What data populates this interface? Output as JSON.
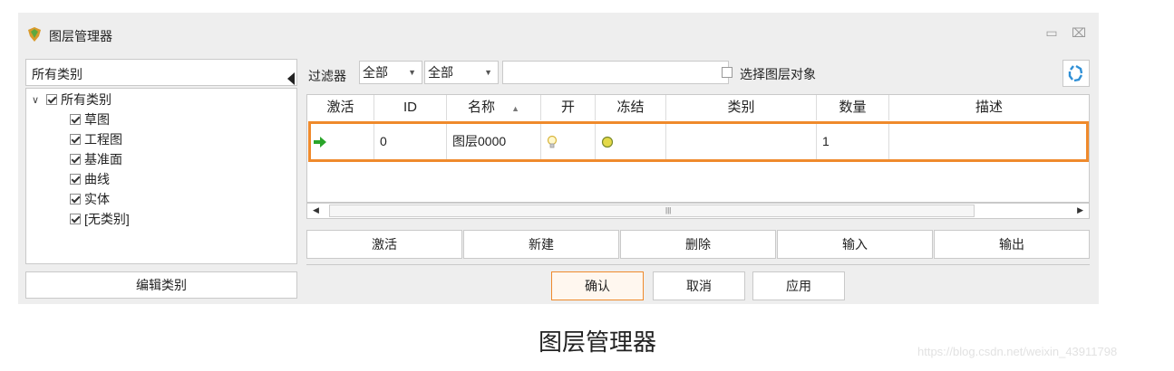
{
  "window": {
    "title": "图层管理器",
    "close_glyph": "⌧",
    "restore_glyph": "▭"
  },
  "sidebar": {
    "header": "所有类别",
    "tree": [
      {
        "label": "所有类别",
        "checked": true,
        "expanded": true
      },
      {
        "label": "草图",
        "checked": true
      },
      {
        "label": "工程图",
        "checked": true
      },
      {
        "label": "基准面",
        "checked": true
      },
      {
        "label": "曲线",
        "checked": true
      },
      {
        "label": "实体",
        "checked": true
      },
      {
        "label": "[无类别]",
        "checked": true
      }
    ],
    "edit_button": "编辑类别"
  },
  "filter": {
    "label": "过滤器",
    "select1": "全部",
    "select2": "全部",
    "search_value": "",
    "select_layer_label": "选择图层对象",
    "select_layer_checked": false
  },
  "table": {
    "columns": [
      "激活",
      "ID",
      "名称",
      "开",
      "冻结",
      "类别",
      "数量",
      "描述"
    ],
    "sort_column": "名称",
    "rows": [
      {
        "active": "arrow-right-icon",
        "id": "0",
        "name": "图层0000",
        "on": "bulb-icon",
        "frozen": "circle-icon",
        "category": "",
        "count": "1",
        "description": ""
      }
    ]
  },
  "actions": [
    "激活",
    "新建",
    "删除",
    "输入",
    "输出"
  ],
  "footer": {
    "ok": "确认",
    "cancel": "取消",
    "apply": "应用"
  },
  "caption": "图层管理器",
  "watermark": "https://blog.csdn.net/weixin_43911798",
  "colors": {
    "highlight": "#ef8a2c",
    "arrow": "#2aa52a",
    "dialog_bg": "#eeeeee"
  }
}
